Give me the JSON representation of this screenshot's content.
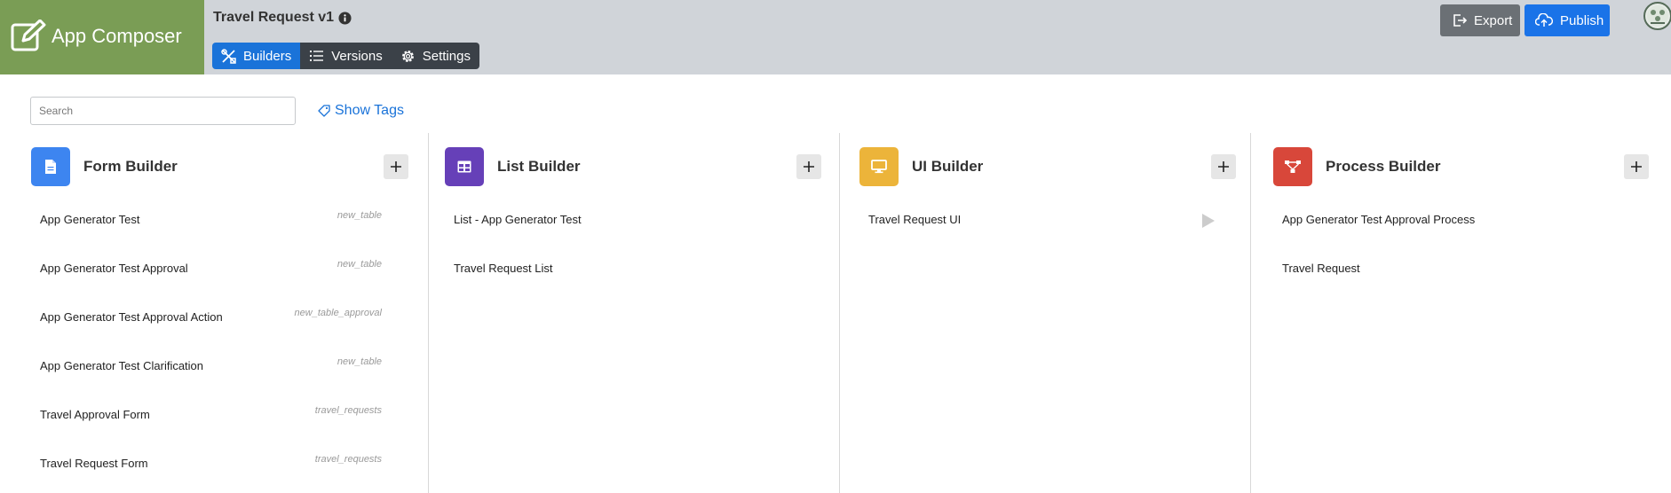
{
  "brand": {
    "title": "App Composer",
    "icon": "edit-icon",
    "color": "#7a9d55"
  },
  "app": {
    "title": "Travel Request v1",
    "info_icon": "info-icon"
  },
  "nav": {
    "builders": "Builders",
    "versions": "Versions",
    "settings": "Settings",
    "active": "Builders"
  },
  "actions": {
    "export": "Export",
    "publish": "Publish"
  },
  "search": {
    "placeholder": "Search",
    "value": ""
  },
  "tags": {
    "label": "Show Tags"
  },
  "columns": [
    {
      "title": "Form Builder",
      "color": "#3d85f0",
      "icon": "document-icon",
      "items": [
        {
          "label": "App Generator Test",
          "tag": "new_table"
        },
        {
          "label": "App Generator Test Approval",
          "tag": "new_table"
        },
        {
          "label": "App Generator Test Approval Action",
          "tag": "new_table_approval"
        },
        {
          "label": "App Generator Test Clarification",
          "tag": "new_table"
        },
        {
          "label": "Travel Approval Form",
          "tag": "travel_requests"
        },
        {
          "label": "Travel Request Form",
          "tag": "travel_requests"
        }
      ]
    },
    {
      "title": "List Builder",
      "color": "#6640b8",
      "icon": "table-icon",
      "items": [
        {
          "label": "List - App Generator Test"
        },
        {
          "label": "Travel Request List"
        }
      ]
    },
    {
      "title": "UI Builder",
      "color": "#ecb43a",
      "icon": "monitor-icon",
      "items": [
        {
          "label": "Travel Request UI",
          "action_icon": "play-icon"
        }
      ]
    },
    {
      "title": "Process Builder",
      "color": "#d8473a",
      "icon": "flow-icon",
      "items": [
        {
          "label": "App Generator Test Approval Process"
        },
        {
          "label": "Travel Request"
        }
      ]
    }
  ]
}
